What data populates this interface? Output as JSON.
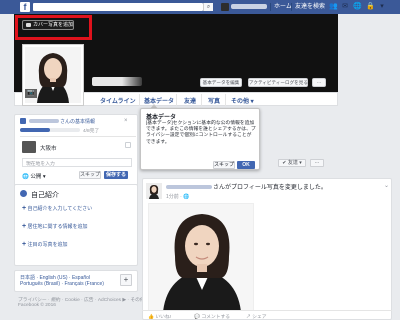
{
  "topbar": {
    "logo": "f",
    "search_placeholder": "",
    "nav": {
      "home": "ホーム",
      "find_friends": "友達を検索"
    }
  },
  "cover": {
    "add_cover_label": "カバー写真を追加",
    "update_info_label": "基本データを編集",
    "activity_log_label": "アクティビティーログを見る",
    "more_label": "···"
  },
  "tabs": [
    {
      "label": "タイムライン"
    },
    {
      "label": "基本データ"
    },
    {
      "label": "友達"
    },
    {
      "label": "写真"
    },
    {
      "label": "その他 ▾"
    }
  ],
  "popup": {
    "title": "基本データ",
    "body": "[基本データ]セクションに基本的な公の情報を追加できます。またこの情報を誰とシェアするかは、プライバシー設定で個別にコントロールすることができます。",
    "skip": "スキップ",
    "ok": "OK"
  },
  "profile_card": {
    "profile_title_suffix": "さんの基本情報",
    "progress_label": "4/8完了",
    "progress_fraction": 0.5,
    "city": "大阪市",
    "input_placeholder": "現在地を入力",
    "privacy": "公開",
    "skip": "スキップ",
    "save": "保存する"
  },
  "intro": {
    "title": "自己紹介",
    "items": [
      "自己紹介を入力してください",
      "居住地に関する情報を追加",
      "注目の写真を追加"
    ]
  },
  "languages": {
    "line1": "日本語 · English (US) · Español",
    "line2": "Português (Brasil) · Français (France)",
    "plus": "+"
  },
  "footer": {
    "links": "プライバシー · 規約 · Cookie · 広告 · AdChoices ▶ · その他 ▾",
    "copyright": "Facebook © 2016"
  },
  "post": {
    "action": "さんがプロフィール写真を変更しました。",
    "time": "1分前 · 🌐",
    "friends_btn": "✔ 友達 ▾",
    "more_btn": "···",
    "like": "いいね!",
    "comment": "コメントする",
    "share": "シェア"
  },
  "colors": {
    "brand": "#3b5998",
    "accent": "#4267b2",
    "highlight": "#e0121c"
  }
}
